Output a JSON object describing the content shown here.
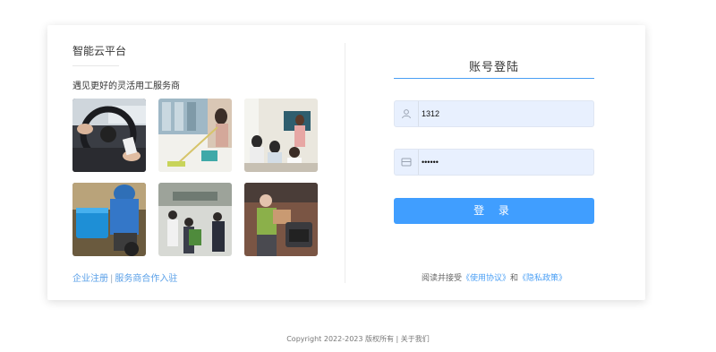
{
  "brand": "智能云平台",
  "slogan": "遇见更好的灵活用工服务商",
  "photos": [
    "driver-photo",
    "cleaning-photo",
    "classroom-photo",
    "delivery-rider-photo",
    "business-meeting-photo",
    "mover-photo"
  ],
  "links": {
    "register": "企业注册",
    "separator": "|",
    "partner": "服务商合作入驻"
  },
  "login": {
    "title": "账号登陆",
    "username_value": "1312",
    "password_value": "••••••",
    "button_label": "登 录"
  },
  "agreement": {
    "prefix": "阅读并接受",
    "terms": "《使用协议》",
    "and": "和",
    "privacy": "《隐私政策》"
  },
  "footer": "Copyright 2022-2023 版权所有 | 关于我们",
  "colors": {
    "accent": "#409eff",
    "input_bg": "#e8f0fe"
  }
}
